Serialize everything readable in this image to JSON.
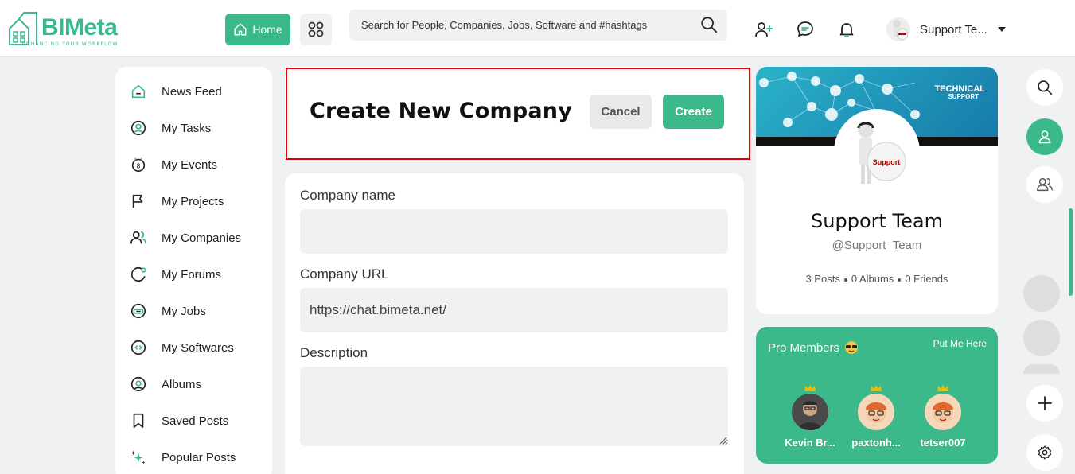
{
  "brand": {
    "name": "BIMeta",
    "tagline": "ENHANCING YOUR WORKFLOW",
    "accent": "#3bb98b"
  },
  "topbar": {
    "home_label": "Home",
    "search_placeholder": "Search for People, Companies, Jobs, Software and #hashtags",
    "user_name": "Support Te...",
    "icons": [
      "home-icon",
      "apps-grid-icon",
      "search-icon",
      "add-user-icon",
      "chat-icon",
      "bell-icon",
      "caret-down-icon"
    ]
  },
  "sidebar": {
    "items": [
      {
        "label": "News Feed",
        "icon": "home-icon"
      },
      {
        "label": "My Tasks",
        "icon": "tasks-icon"
      },
      {
        "label": "My Events",
        "icon": "calendar-icon"
      },
      {
        "label": "My Projects",
        "icon": "flag-icon"
      },
      {
        "label": "My Companies",
        "icon": "users-icon"
      },
      {
        "label": "My Forums",
        "icon": "forum-icon"
      },
      {
        "label": "My Jobs",
        "icon": "briefcase-icon"
      },
      {
        "label": "My Softwares",
        "icon": "software-icon"
      },
      {
        "label": "Albums",
        "icon": "album-icon"
      },
      {
        "label": "Saved Posts",
        "icon": "bookmark-icon"
      },
      {
        "label": "Popular Posts",
        "icon": "sparkle-icon"
      }
    ]
  },
  "create": {
    "title": "Create New Company",
    "cancel_label": "Cancel",
    "create_label": "Create"
  },
  "form": {
    "company_name_label": "Company name",
    "company_name_value": "",
    "company_url_label": "Company URL",
    "company_url_value": "https://chat.bimeta.net/",
    "description_label": "Description",
    "description_value": ""
  },
  "profile": {
    "cover_line1": "TECHNICAL",
    "cover_line2": "SUPPORT",
    "avatar_text": "Support",
    "name": "Support Team",
    "handle": "@Support_Team",
    "posts": "3 Posts",
    "albums": "0 Albums",
    "friends": "0 Friends"
  },
  "pro_members": {
    "title": "Pro Members",
    "link": "Put Me Here",
    "members": [
      {
        "name": "Kevin Br..."
      },
      {
        "name": "paxtonh..."
      },
      {
        "name": "tetser007"
      }
    ]
  }
}
